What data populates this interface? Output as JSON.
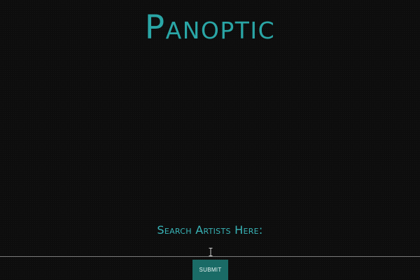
{
  "header": {
    "title": "Panoptic"
  },
  "search": {
    "label": "Search Artists Here:",
    "value": "",
    "placeholder": ""
  },
  "actions": {
    "submit_label": "SUBMIT"
  },
  "colors": {
    "background": "#0d0d0d",
    "accent": "#2aa6a6",
    "button": "#1a6b66"
  },
  "icons": {
    "cursor": "text-cursor-icon"
  }
}
